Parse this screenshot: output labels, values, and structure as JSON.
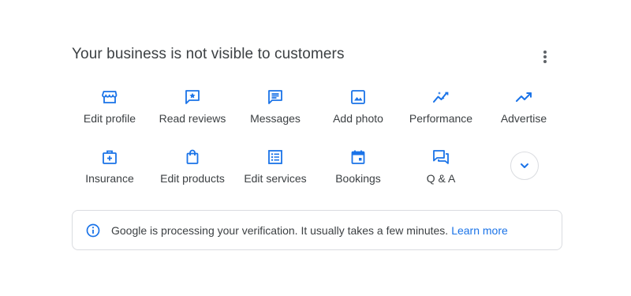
{
  "header": {
    "title": "Your business is not visible to customers",
    "more_icon": "more-vert-icon"
  },
  "actions": [
    {
      "label": "Edit profile",
      "icon": "storefront-icon"
    },
    {
      "label": "Read reviews",
      "icon": "review-icon"
    },
    {
      "label": "Messages",
      "icon": "message-icon"
    },
    {
      "label": "Add photo",
      "icon": "photo-icon"
    },
    {
      "label": "Performance",
      "icon": "performance-icon"
    },
    {
      "label": "Advertise",
      "icon": "trending-up-icon"
    },
    {
      "label": "Insurance",
      "icon": "medical-bag-icon"
    },
    {
      "label": "Edit products",
      "icon": "shopping-bag-icon"
    },
    {
      "label": "Edit services",
      "icon": "list-icon"
    },
    {
      "label": "Bookings",
      "icon": "calendar-icon"
    },
    {
      "label": "Q & A",
      "icon": "forum-icon"
    }
  ],
  "expand": {
    "icon": "chevron-down-icon"
  },
  "notice": {
    "icon": "info-icon",
    "message": "Google is processing your verification. It usually takes a few minutes.",
    "link": "Learn more"
  },
  "colors": {
    "accent": "#1a73e8",
    "text": "#3c4043",
    "border": "#dadce0"
  }
}
